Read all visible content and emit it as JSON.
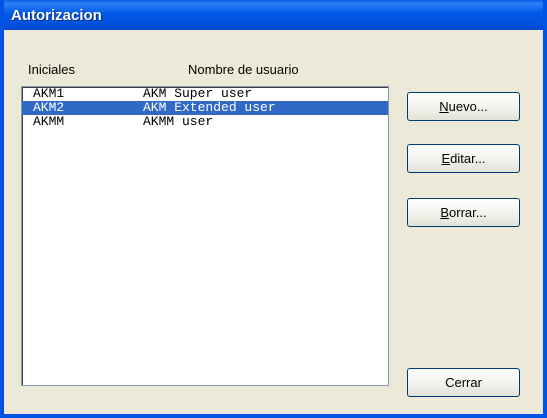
{
  "window": {
    "title": "Autorizacion"
  },
  "columns": {
    "initials": "Iniciales",
    "username": "Nombre de usuario"
  },
  "users": [
    {
      "initials": "AKM1",
      "name": "AKM Super user",
      "selected": false
    },
    {
      "initials": "AKM2",
      "name": "AKM Extended user",
      "selected": true
    },
    {
      "initials": "AKMM",
      "name": "AKMM user",
      "selected": false
    }
  ],
  "buttons": {
    "new": {
      "mnemonic": "N",
      "rest": "uevo..."
    },
    "edit": {
      "mnemonic": "E",
      "rest": "ditar..."
    },
    "delete": {
      "mnemonic": "B",
      "rest": "orrar..."
    },
    "close": {
      "label": "Cerrar"
    }
  },
  "colors": {
    "titlebar": "#0054e3",
    "selection": "#316ac5",
    "dialog_bg": "#ece9d8"
  }
}
